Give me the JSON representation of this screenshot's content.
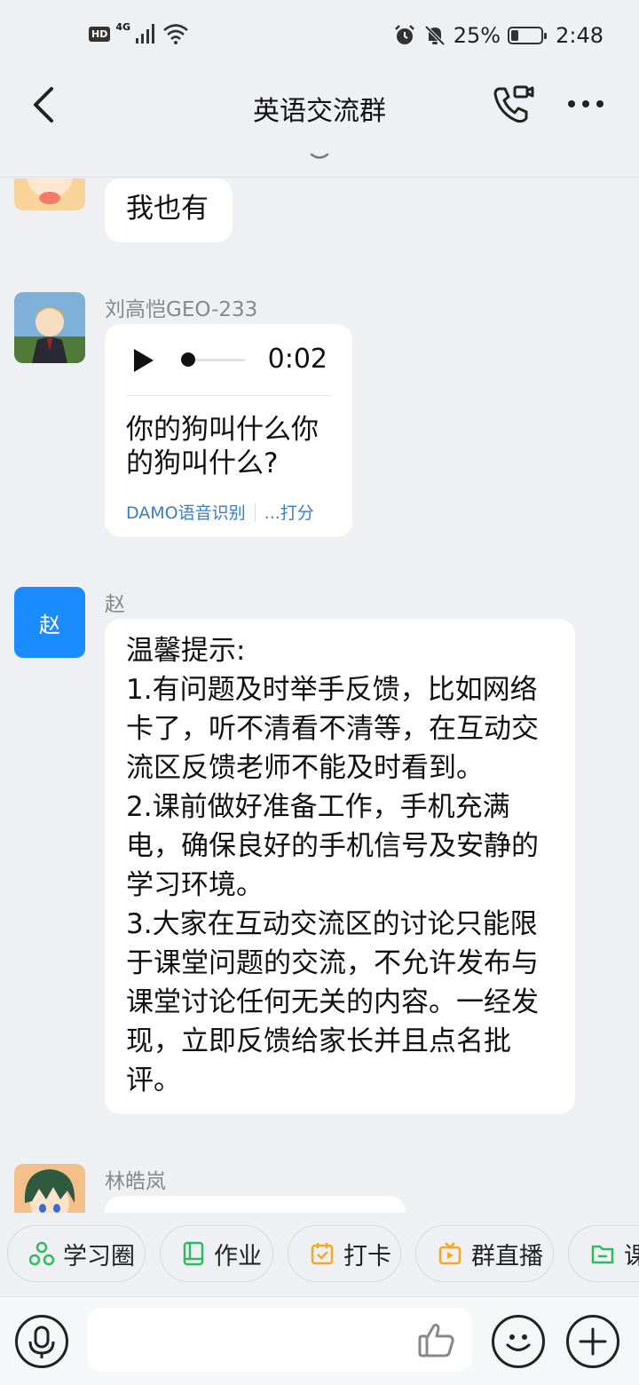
{
  "status_bar": {
    "hd": "HD",
    "net": "4G",
    "battery_text": "25%",
    "battery_level": 0.25,
    "time": "2:48"
  },
  "header": {
    "title": "英语交流群",
    "icons": [
      "back-icon",
      "video-call-icon",
      "more-icon"
    ]
  },
  "messages": [
    {
      "sender": "",
      "text": "我也有"
    },
    {
      "sender": "刘高恺GEO-233",
      "voice_duration": "0:02",
      "transcript": [
        "你的狗叫什么你",
        "的狗叫什么?"
      ],
      "actions": [
        "DAMO语音识别",
        "...打分"
      ]
    },
    {
      "sender": "赵",
      "avatar_text": "赵",
      "lines": [
        "温馨提示:",
        "1.有问题及时举手反馈，比如网络",
        "卡了，听不清看不清等，在互动交",
        "流区反馈老师不能及时看到。",
        "2.课前做好准备工作，手机充满",
        "电，确保良好的手机信号及安静的",
        "学习环境。",
        "3.大家在互动交流区的讨论只能限",
        "于课堂问题的交流，不允许发布与",
        "课堂讨论任何无关的内容。一经发",
        "现，立即反馈给家长并且点名批",
        "评。"
      ]
    },
    {
      "sender": "林皓岚"
    }
  ],
  "shortcuts": [
    {
      "label": "学习圈",
      "icon": "study-circle-icon",
      "color": "#2dbb62"
    },
    {
      "label": "作业",
      "icon": "homework-book-icon",
      "color": "#2dbb62"
    },
    {
      "label": "打卡",
      "icon": "checkin-calendar-icon",
      "color": "#f5a623"
    },
    {
      "label": "群直播",
      "icon": "live-tv-icon",
      "color": "#f5a623"
    },
    {
      "label": "课",
      "icon": "folder-icon",
      "color": "#2dbb62"
    }
  ],
  "input": {
    "icons": [
      "microphone-icon",
      "thumbs-up-icon",
      "emoji-icon",
      "plus-icon"
    ]
  }
}
